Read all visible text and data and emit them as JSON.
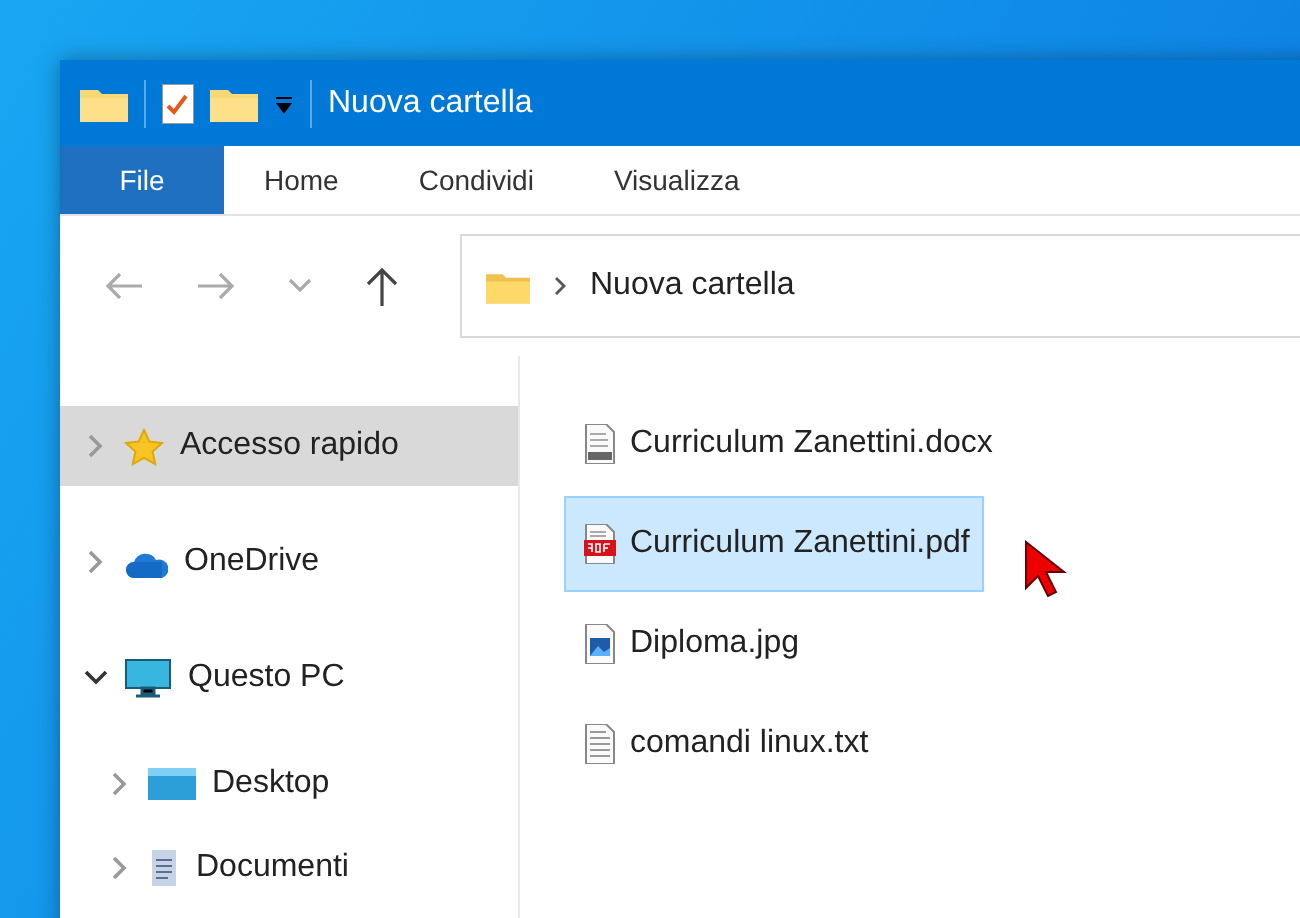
{
  "window": {
    "title": "Nuova cartella"
  },
  "ribbon_tabs": [
    {
      "label": "File",
      "kind": "file",
      "selected": false
    },
    {
      "label": "Home",
      "kind": "tab",
      "selected": false
    },
    {
      "label": "Condividi",
      "kind": "tab",
      "selected": false
    },
    {
      "label": "Visualizza",
      "kind": "tab",
      "selected": false
    }
  ],
  "address_bar": {
    "path": "Nuova cartella"
  },
  "sidebar": {
    "items": [
      {
        "label": "Accesso rapido",
        "kind": "star",
        "selected": true,
        "expanded": false
      },
      {
        "label": "OneDrive",
        "kind": "cloud",
        "selected": false,
        "expanded": false
      },
      {
        "label": "Questo PC",
        "kind": "monitor",
        "selected": false,
        "expanded": true,
        "children": [
          {
            "label": "Desktop",
            "kind": "desktop",
            "selected": false,
            "expanded": false
          },
          {
            "label": "Documenti",
            "kind": "document",
            "selected": false,
            "expanded": false
          }
        ]
      }
    ]
  },
  "files": [
    {
      "name": "Curriculum Zanettini.docx",
      "kind": "docx",
      "selected": false
    },
    {
      "name": "Curriculum Zanettini.pdf",
      "kind": "pdf",
      "selected": true
    },
    {
      "name": "Diploma.jpg",
      "kind": "image",
      "selected": false
    },
    {
      "name": "comandi linux.txt",
      "kind": "text",
      "selected": false
    }
  ]
}
